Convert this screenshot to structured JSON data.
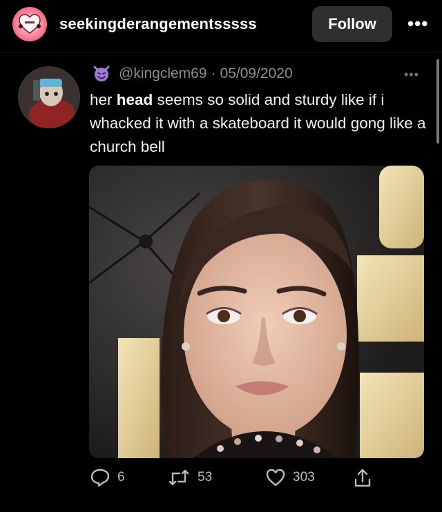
{
  "header": {
    "account_name": "seekingderangementsssss",
    "follow_label": "Follow",
    "more_label": "•••"
  },
  "tweet": {
    "handle": "@kingclem69",
    "separator": "·",
    "date": "05/09/2020",
    "more_label": "•••",
    "text_before": "her ",
    "text_bold": "head",
    "text_after": " seems so solid and sturdy like if i whacked it with a skateboard it would gong like a church bell"
  },
  "actions": {
    "replies": "6",
    "retweets": "53",
    "likes": "303"
  },
  "icons": {
    "profile": "heart-logo-icon",
    "emoji": "smiling-devil-icon",
    "reply": "reply-icon",
    "retweet": "retweet-icon",
    "like": "heart-icon",
    "share": "share-icon"
  }
}
